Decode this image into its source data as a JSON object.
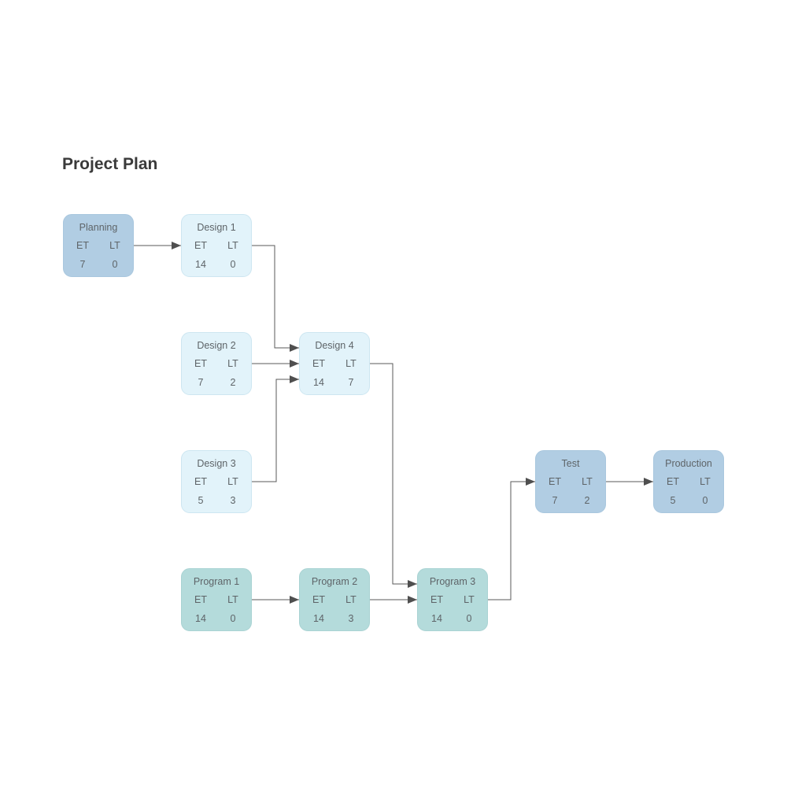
{
  "title": "Project Plan",
  "labels": {
    "et": "ET",
    "lt": "LT"
  },
  "nodes": [
    {
      "id": "planning",
      "name": "Planning",
      "et": "7",
      "lt": "0",
      "style": "blue",
      "col": 0,
      "row": 0
    },
    {
      "id": "design1",
      "name": "Design 1",
      "et": "14",
      "lt": "0",
      "style": "light",
      "col": 1,
      "row": 0
    },
    {
      "id": "design2",
      "name": "Design 2",
      "et": "7",
      "lt": "2",
      "style": "light",
      "col": 1,
      "row": 1
    },
    {
      "id": "design3",
      "name": "Design 3",
      "et": "5",
      "lt": "3",
      "style": "light",
      "col": 1,
      "row": 2
    },
    {
      "id": "design4",
      "name": "Design 4",
      "et": "14",
      "lt": "7",
      "style": "light",
      "col": 2,
      "row": 1
    },
    {
      "id": "program1",
      "name": "Program 1",
      "et": "14",
      "lt": "0",
      "style": "teal",
      "col": 1,
      "row": 3
    },
    {
      "id": "program2",
      "name": "Program 2",
      "et": "14",
      "lt": "3",
      "style": "teal",
      "col": 2,
      "row": 3
    },
    {
      "id": "program3",
      "name": "Program 3",
      "et": "14",
      "lt": "0",
      "style": "teal",
      "col": 3,
      "row": 3
    },
    {
      "id": "test",
      "name": "Test",
      "et": "7",
      "lt": "2",
      "style": "blue",
      "col": 4,
      "row": 2
    },
    {
      "id": "production",
      "name": "Production",
      "et": "5",
      "lt": "0",
      "style": "blue",
      "col": 5,
      "row": 2
    }
  ],
  "edges": [
    {
      "from": "planning",
      "to": "design1"
    },
    {
      "from": "design1",
      "to": "design4"
    },
    {
      "from": "design2",
      "to": "design4"
    },
    {
      "from": "design3",
      "to": "design4"
    },
    {
      "from": "design4",
      "to": "program3"
    },
    {
      "from": "program1",
      "to": "program2"
    },
    {
      "from": "program2",
      "to": "program3"
    },
    {
      "from": "program3",
      "to": "test"
    },
    {
      "from": "test",
      "to": "production"
    }
  ]
}
